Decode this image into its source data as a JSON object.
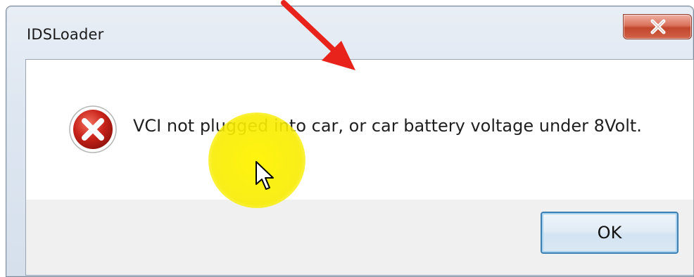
{
  "window": {
    "title": "IDSLoader",
    "close_icon": "close-x-icon"
  },
  "dialog": {
    "icon": "error-x-icon",
    "message": "VCI not plugged into car, or car battery voltage under 8Volt.",
    "ok_label": "OK"
  },
  "overlays": {
    "highlight_color": "#f8ec00",
    "arrow_color": "#e8231c",
    "cursor_icon": "mouse-pointer-icon",
    "arrow_icon": "red-arrow-annotation-icon"
  }
}
